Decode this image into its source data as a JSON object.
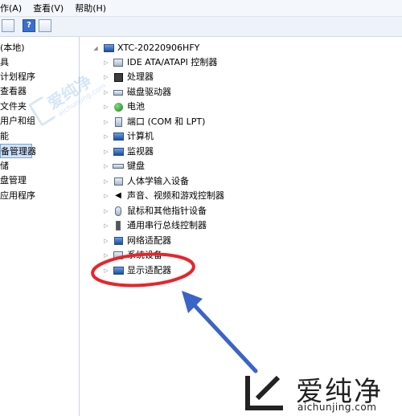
{
  "menu": {
    "action": "作(A)",
    "view": "查看(V)",
    "help": "帮助(H)"
  },
  "left_tree": [
    "(本地)",
    "具",
    "计划程序",
    "查看器",
    "文件夹",
    "用户和组",
    "能",
    "备管理器",
    "储",
    "盘管理",
    "应用程序"
  ],
  "device_tree": {
    "root": "XTC-20220906HFY",
    "items": [
      {
        "label": "IDE ATA/ATAPI 控制器",
        "icon": "ide-controller-icon"
      },
      {
        "label": "处理器",
        "icon": "processor-icon"
      },
      {
        "label": "磁盘驱动器",
        "icon": "disk-drive-icon"
      },
      {
        "label": "电池",
        "icon": "battery-icon"
      },
      {
        "label": "端口 (COM 和 LPT)",
        "icon": "port-icon"
      },
      {
        "label": "计算机",
        "icon": "computer-icon"
      },
      {
        "label": "监视器",
        "icon": "monitor-icon"
      },
      {
        "label": "键盘",
        "icon": "keyboard-icon"
      },
      {
        "label": "人体学输入设备",
        "icon": "hid-icon"
      },
      {
        "label": "声音、视频和游戏控制器",
        "icon": "sound-icon"
      },
      {
        "label": "鼠标和其他指针设备",
        "icon": "mouse-icon"
      },
      {
        "label": "通用串行总线控制器",
        "icon": "usb-icon"
      },
      {
        "label": "网络适配器",
        "icon": "network-adapter-icon"
      },
      {
        "label": "系统设备",
        "icon": "system-device-icon"
      },
      {
        "label": "显示适配器",
        "icon": "display-adapter-icon"
      }
    ]
  },
  "watermark": {
    "name": "爱纯净",
    "url": "aichunjing.com"
  },
  "colors": {
    "annotation_red": "#e8242a",
    "arrow_blue": "#3b64c8",
    "selection": "#cfe3fb"
  }
}
